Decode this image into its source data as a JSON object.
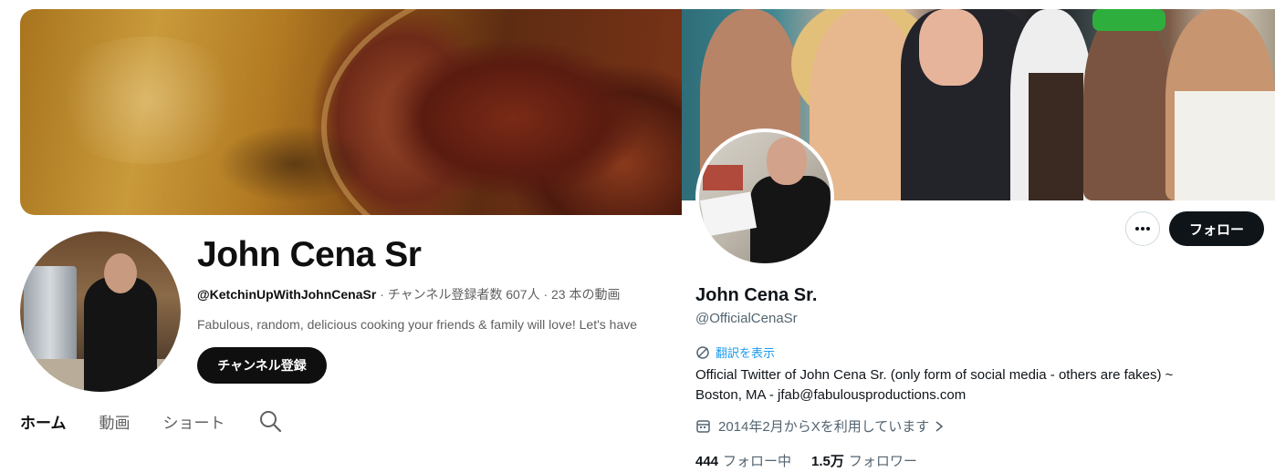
{
  "youtube": {
    "title": "John Cena Sr",
    "handle": "@KetchinUpWithJohnCenaSr",
    "meta_rest": " · チャンネル登録者数 607人 · 23 本の動画",
    "description": "Fabulous, random, delicious cooking your friends & family will love! Let's have",
    "subscribe_label": "チャンネル登録",
    "tabs": [
      "ホーム",
      "動画",
      "ショート"
    ],
    "search_icon": "search-icon"
  },
  "x": {
    "name": "John Cena Sr.",
    "handle": "@OfficialCenaSr",
    "translate_label": "翻訳を表示",
    "bio_line1": "Official Twitter of John Cena Sr. (only form of social media - others are fakes) ~",
    "bio_line2": "Boston, MA - jfab@fabulousproductions.com",
    "joined": "2014年2月からXを利用しています",
    "follow_label": "フォロー",
    "following_count": "444",
    "following_label": "フォロー中",
    "followers_count": "1.5万",
    "followers_label": "フォロワー"
  },
  "colors": {
    "x_link": "#1d9bf0",
    "x_secondary": "#536471",
    "yt_secondary": "#606060",
    "button_dark": "#0f0f0f"
  }
}
